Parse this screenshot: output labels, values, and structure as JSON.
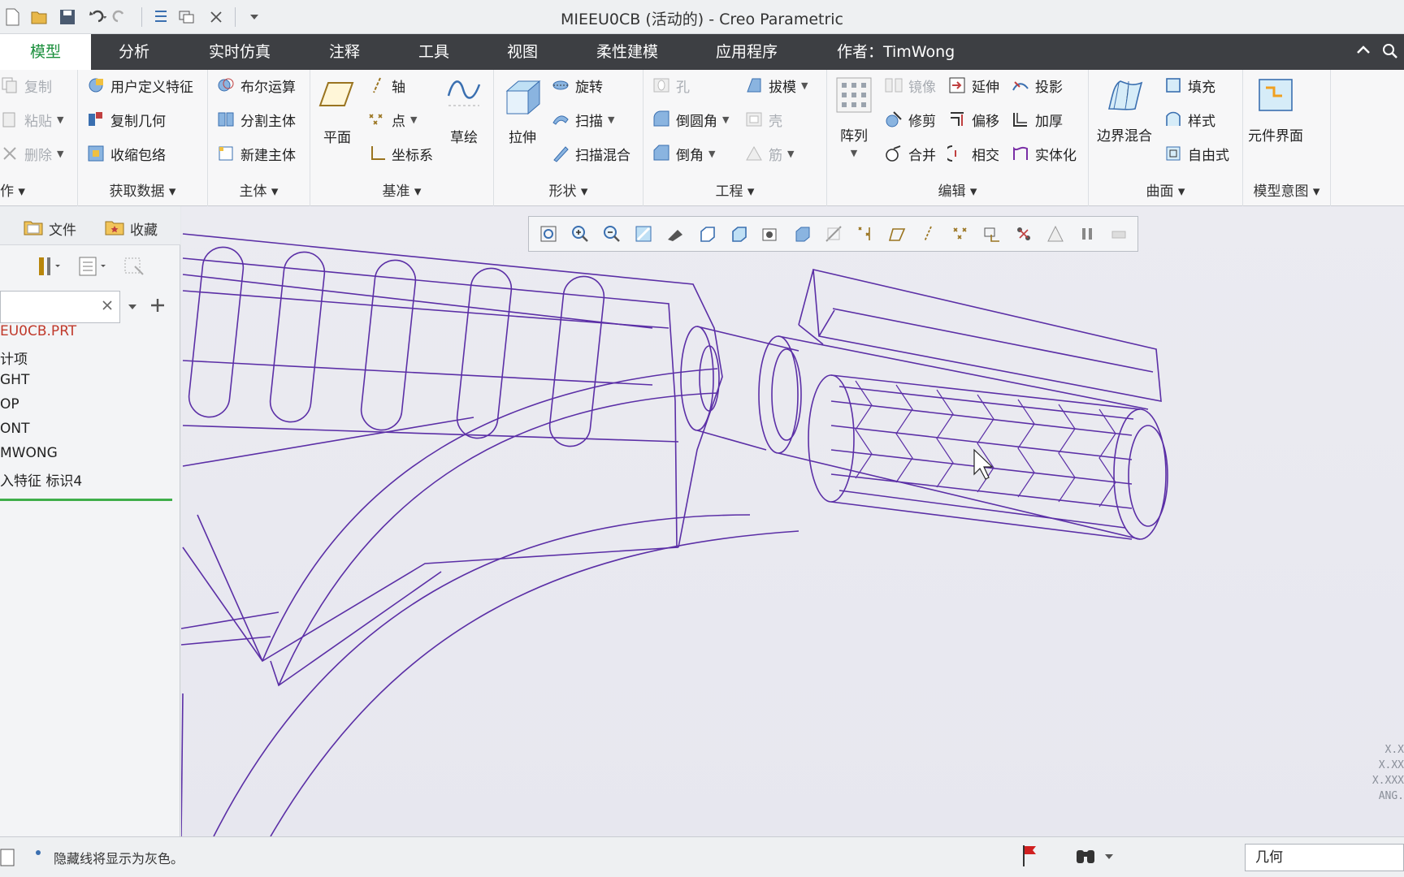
{
  "window": {
    "title": "MIEEU0CB (活动的) - Creo Parametric"
  },
  "menu": {
    "tabs": [
      "模型",
      "分析",
      "实时仿真",
      "注释",
      "工具",
      "视图",
      "柔性建模",
      "应用程序"
    ],
    "active_tab": "模型",
    "author_label": "作者：TimWong"
  },
  "ribbon": {
    "clipboard": {
      "copy": "复制",
      "paste": "粘贴",
      "delete": "删除",
      "label": "作"
    },
    "get_data": {
      "udf": "用户定义特征",
      "copy_geom": "复制几何",
      "shrinkwrap": "收缩包络",
      "label": "获取数据"
    },
    "body": {
      "boolean": "布尔运算",
      "split": "分割主体",
      "new_body": "新建主体",
      "label": "主体"
    },
    "datum": {
      "plane": "平面",
      "axis": "轴",
      "point": "点",
      "csys": "坐标系",
      "sketch": "草绘",
      "label": "基准"
    },
    "shape": {
      "extrude": "拉伸",
      "revolve": "旋转",
      "sweep": "扫描",
      "swept_blend": "扫描混合",
      "label": "形状"
    },
    "engineering": {
      "hole": "孔",
      "draft": "拔模",
      "round": "倒圆角",
      "shell": "壳",
      "chamfer": "倒角",
      "rib": "筋",
      "label": "工程"
    },
    "editing": {
      "pattern": "阵列",
      "mirror": "镜像",
      "extend": "延伸",
      "project": "投影",
      "trim": "修剪",
      "offset": "偏移",
      "thicken": "加厚",
      "merge": "合并",
      "intersect": "相交",
      "solidify": "实体化",
      "label": "编辑"
    },
    "surfaces": {
      "boundary_blend": "边界混合",
      "fill": "填充",
      "style": "样式",
      "freestyle": "自由式",
      "label": "曲面"
    },
    "model_intent": {
      "component_interface": "元件界面",
      "label": "模型意图"
    }
  },
  "left_panel": {
    "tabs": [
      "文件",
      "收藏"
    ],
    "search_value": "",
    "tree": [
      "EU0CB.PRT",
      "计项",
      "GHT",
      "OP",
      "ONT",
      "MWONG",
      "入特征 标识4"
    ]
  },
  "graphics": {
    "units_legend": [
      "X.X",
      "X.XX",
      "X.XXX",
      "ANG."
    ],
    "wire_color": "#5b2fa6"
  },
  "status": {
    "message": "隐藏线将显示为灰色。",
    "filter_value": "几何"
  }
}
